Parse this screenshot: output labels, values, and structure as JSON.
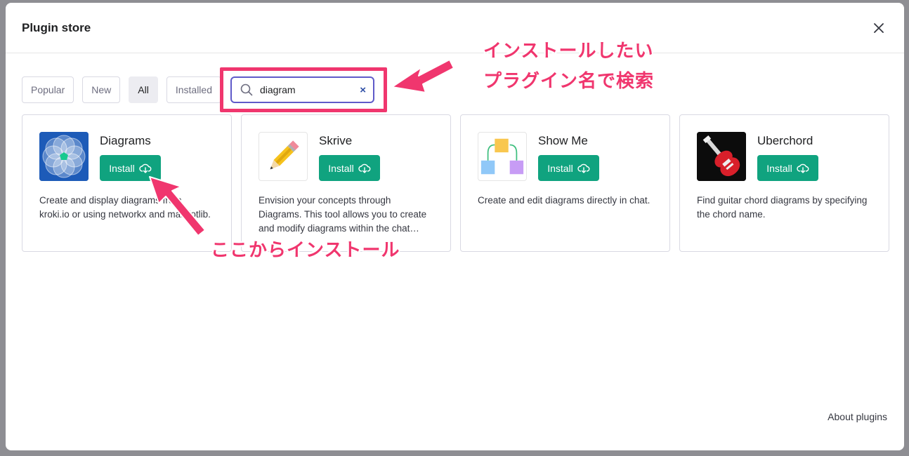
{
  "modal": {
    "title": "Plugin store",
    "close_icon": "close-icon"
  },
  "filters": [
    {
      "label": "Popular",
      "active": false
    },
    {
      "label": "New",
      "active": false
    },
    {
      "label": "All",
      "active": true
    },
    {
      "label": "Installed",
      "active": false
    }
  ],
  "search": {
    "value": "diagram",
    "icon": "search-icon",
    "clear_label": "×"
  },
  "plugins": [
    {
      "name": "Diagrams",
      "install_label": "Install",
      "description": "Create and display diagrams from kroki.io or using networkx and matplotlib.",
      "logo": "diagrams-logo"
    },
    {
      "name": "Skrive",
      "install_label": "Install",
      "description": "Envision your concepts through Diagrams. This tool allows you to create and modify diagrams within the chat…",
      "logo": "pencil-logo"
    },
    {
      "name": "Show Me",
      "install_label": "Install",
      "description": "Create and edit diagrams directly in chat.",
      "logo": "flowchart-logo"
    },
    {
      "name": "Uberchord",
      "install_label": "Install",
      "description": "Find guitar chord diagrams by specifying the chord name.",
      "logo": "guitar-logo"
    }
  ],
  "footer": {
    "about_label": "About plugins"
  },
  "annotations": {
    "search_line1": "インストールしたい",
    "search_line2": "プラグイン名で検索",
    "install_note": "ここからインストール",
    "color": "#f0366e"
  },
  "colors": {
    "install_green": "#10a37f",
    "search_border": "#5f5ac9"
  }
}
